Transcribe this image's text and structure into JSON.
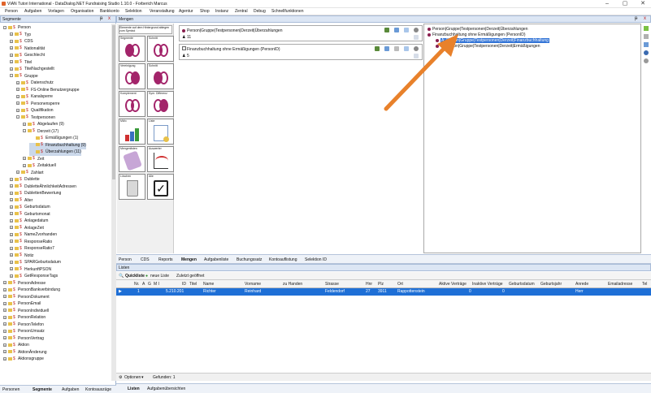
{
  "window": {
    "title": "VIAN Tutori International - DataDialog.NET Fundraising Studio 1.10.0 - Forberich Marcus",
    "minimize": "–",
    "maximize": "▢",
    "close": "✕"
  },
  "menu": [
    "Person",
    "Aufgaben",
    "Vorlagen",
    "Organisation",
    "Bankkonto",
    "Selektion",
    "Veranstaltung",
    "Agentur",
    "Shop",
    "Instanz",
    "Zentral",
    "Debug",
    "Schnellfunktionen"
  ],
  "segmente": {
    "title": "Segmente",
    "pin": "ᵽ",
    "close": "x",
    "tree": [
      {
        "label": "Person",
        "indent": 0,
        "exp": "-"
      },
      {
        "label": "Typ",
        "indent": 1,
        "exp": "+"
      },
      {
        "label": "CDS",
        "indent": 1,
        "exp": "+"
      },
      {
        "label": "Nationalität",
        "indent": 1,
        "exp": "+"
      },
      {
        "label": "Geschlecht",
        "indent": 1,
        "exp": "+"
      },
      {
        "label": "Titel",
        "indent": 1,
        "exp": "+"
      },
      {
        "label": "TitelNachgestellt",
        "indent": 1,
        "exp": "+"
      },
      {
        "label": "Gruppe",
        "indent": 1,
        "exp": "-"
      },
      {
        "label": "Datenschutz",
        "indent": 2,
        "exp": "+"
      },
      {
        "label": "FS-Online Benutzergruppe",
        "indent": 2,
        "exp": "+"
      },
      {
        "label": "Kanalsperre",
        "indent": 2,
        "exp": "+"
      },
      {
        "label": "Personensperre",
        "indent": 2,
        "exp": "+"
      },
      {
        "label": "Qualifikation",
        "indent": 2,
        "exp": "+"
      },
      {
        "label": "Testpersonen",
        "indent": 2,
        "exp": "-"
      },
      {
        "label": "Abgelaufen (9)",
        "indent": 3,
        "exp": "+"
      },
      {
        "label": "Derzeit (17)",
        "indent": 3,
        "exp": "-"
      },
      {
        "label": "Ermäßigungen (1)",
        "indent": 4,
        "exp": ""
      },
      {
        "label": "Finanzbuchhaltung (9)",
        "indent": 4,
        "exp": "",
        "sel": true
      },
      {
        "label": "Überzahlungen (11)",
        "indent": 4,
        "exp": "",
        "sel": true
      },
      {
        "label": "Zeit",
        "indent": 3,
        "exp": "+"
      },
      {
        "label": "Zeitaktuell",
        "indent": 3,
        "exp": "+"
      },
      {
        "label": "Zahlart",
        "indent": 2,
        "exp": "+"
      },
      {
        "label": "Dublette",
        "indent": 1,
        "exp": "+"
      },
      {
        "label": "DubletteÄhnlichkeitAdressen",
        "indent": 1,
        "exp": "+"
      },
      {
        "label": "DublettenBewertung",
        "indent": 1,
        "exp": "+"
      },
      {
        "label": "Alter",
        "indent": 1,
        "exp": "+"
      },
      {
        "label": "Geburtsdatum",
        "indent": 1,
        "exp": "+"
      },
      {
        "label": "Geburtsmonat",
        "indent": 1,
        "exp": "+"
      },
      {
        "label": "Anlagedatum",
        "indent": 1,
        "exp": "+"
      },
      {
        "label": "AnlageZeit",
        "indent": 1,
        "exp": "+"
      },
      {
        "label": "NameZvorhanden",
        "indent": 1,
        "exp": "+"
      },
      {
        "label": "ResponseRatio",
        "indent": 1,
        "exp": "+"
      },
      {
        "label": "ResponseRatio7",
        "indent": 1,
        "exp": "+"
      },
      {
        "label": "Notiz",
        "indent": 1,
        "exp": "+"
      },
      {
        "label": "SPARGeburtsdatum",
        "indent": 1,
        "exp": "+"
      },
      {
        "label": "HerkunftPSON",
        "indent": 1,
        "exp": "+"
      },
      {
        "label": "GetResponseTags",
        "indent": 1,
        "exp": "+"
      },
      {
        "label": "PersonAdresse",
        "indent": 0,
        "exp": "+"
      },
      {
        "label": "PersonBankverbindung",
        "indent": 0,
        "exp": "+"
      },
      {
        "label": "PersonDokument",
        "indent": 0,
        "exp": "+"
      },
      {
        "label": "PersonEmail",
        "indent": 0,
        "exp": "+"
      },
      {
        "label": "PersonIndividuell",
        "indent": 0,
        "exp": "+"
      },
      {
        "label": "PersonRelation",
        "indent": 0,
        "exp": "+"
      },
      {
        "label": "PersonTelefon",
        "indent": 0,
        "exp": "+"
      },
      {
        "label": "PersonUmsatz",
        "indent": 0,
        "exp": "+"
      },
      {
        "label": "PersonVertrag",
        "indent": 0,
        "exp": "+"
      },
      {
        "label": "Aktion",
        "indent": 0,
        "exp": "+"
      },
      {
        "label": "AktionÄnderung",
        "indent": 0,
        "exp": "+"
      },
      {
        "label": "Aktionsgruppe",
        "indent": 0,
        "exp": "+"
      }
    ],
    "tabs": [
      "Personen",
      "Segmente",
      "Aufgaben",
      "Kontoauszüge"
    ]
  },
  "mengen": {
    "title": "Mengen",
    "pin": "ᵽ",
    "close": "x",
    "palette": [
      {
        "label": "Segmente",
        "kind": "venn"
      },
      {
        "label": "Schnitt",
        "kind": "venn"
      },
      {
        "label": "Vereinigung",
        "kind": "venn"
      },
      {
        "label": "Schnitt",
        "kind": "venn"
      },
      {
        "label": "Komplement",
        "kind": "venn"
      },
      {
        "label": "Sym. Differenz",
        "kind": "venn"
      },
      {
        "label": "Mit/o",
        "kind": "bars"
      },
      {
        "label": "Liste",
        "kind": "list"
      },
      {
        "label": "Mengenlisten",
        "kind": "tag"
      },
      {
        "label": "Auswerter",
        "kind": "chart"
      },
      {
        "label": "Löschen",
        "kind": "trash"
      },
      {
        "label": "Alle",
        "kind": "check"
      }
    ],
    "palette_tip": "Elemente auf dem Hintergrund ablegen zum Symbol",
    "sets": [
      {
        "name": "Person|Gruppe|Testpersonen|Derzeit|Überzahlungen",
        "count": "11"
      },
      {
        "name": "Finanzbuchhaltung ohne Ermäßigungen (PersonID)",
        "count": "5"
      }
    ],
    "result": [
      {
        "label": "Person|Gruppe|Testpersonen|Derzeit|Überzahlungen",
        "indent": 0,
        "hl": false
      },
      {
        "label": "Finanzbuchhaltung ohne Ermäßigungen (PersonID)",
        "indent": 0,
        "hl": false
      },
      {
        "label": "A: Person|Gruppe|Testpersonen|Derzeit|Finanzbuchhaltung",
        "indent": 1,
        "hl": true
      },
      {
        "label": "B: Person|Gruppe|Testpersonen|Derzeit|Ermäßigungen",
        "indent": 1,
        "hl": false
      }
    ],
    "tabs": [
      "Person",
      "CDS",
      "Reports",
      "Mengen",
      "Aufgabenliste",
      "Buchungssatz",
      "Kontoauflistung",
      "Selektion ID"
    ]
  },
  "listen": {
    "title": "Listen",
    "toolbar": [
      "Quickliste",
      "neue Liste",
      "Zuletzt geöffnet"
    ],
    "columns": [
      "Nr.",
      "A",
      "G",
      "M I",
      "ID",
      "Titel",
      "Name",
      "Vorname",
      "zu Handen",
      "Strasse",
      "Hnr",
      "Plz",
      "Ort",
      "Aktive Verträge",
      "Inaktive Verträge",
      "Geburtsdatum",
      "Geburtsjahr",
      "Anrede",
      "Emailadresse",
      "Tel"
    ],
    "row": {
      "nr": "1",
      "id": "5.210.201",
      "name": "Richter",
      "vorname": "Reinhard",
      "strasse": "Feldendorf",
      "hnr": "27",
      "plz": "3911",
      "ort": "Rappottenstein",
      "aktiv": "0",
      "inaktiv": "0",
      "anrede": "Herr"
    },
    "optionen": "Optionen",
    "gefunden": "Gefunden: 1",
    "tabs": [
      "Listen",
      "Aufgabenübersichten"
    ]
  },
  "colors": {
    "accent": "#1e6fd6",
    "arrow": "#e8812b",
    "venn": "#a3246a"
  }
}
